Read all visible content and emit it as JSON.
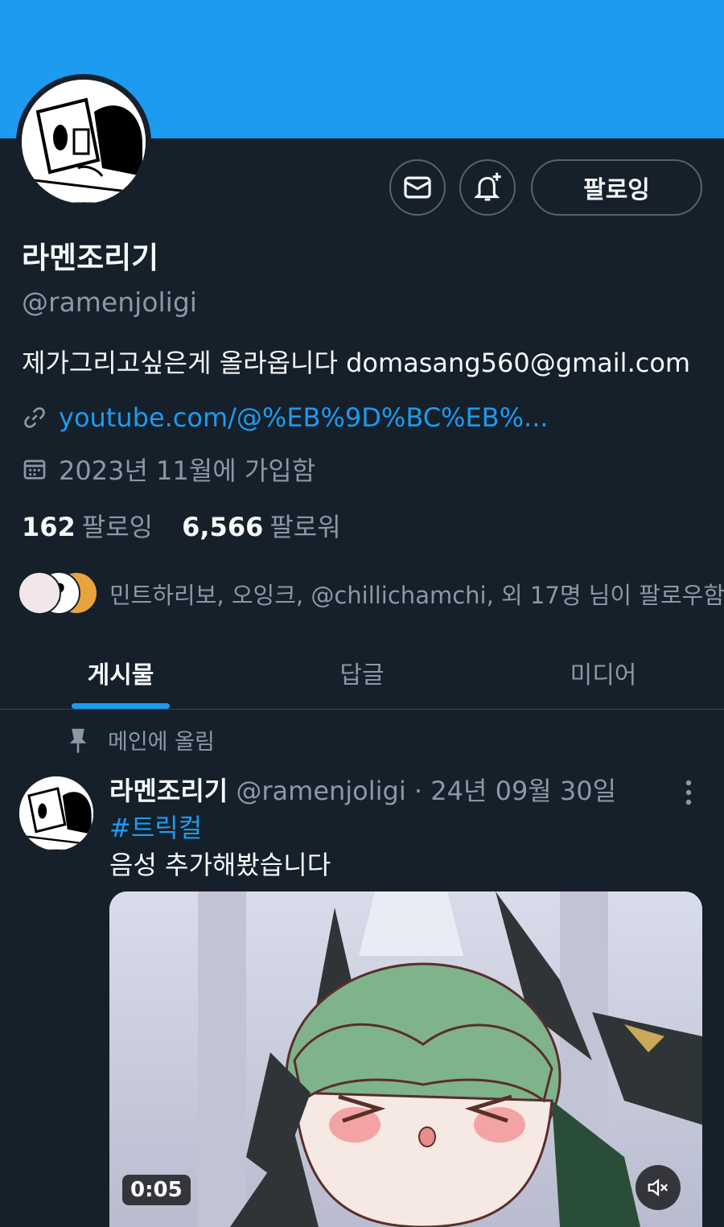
{
  "profile": {
    "display_name": "라멘조리기",
    "handle": "@ramenjoligi",
    "bio": "제가그리고싶은게 올라옵니다  domasang560@gmail.com",
    "link": "youtube.com/@%EB%9D%BC%EB%...",
    "joined": "2023년 11월에 가입함",
    "following_count": "162",
    "following_label": "팔로잉",
    "followers_count": "6,566",
    "followers_label": "팔로워",
    "followers_you_know": "민트하리보, 오잉크, @chillichamchi, 외 17명 님이 팔로우함"
  },
  "actions": {
    "follow_label": "팔로잉",
    "message_icon": "mail-icon",
    "notify_icon": "bell-plus-icon"
  },
  "tabs": [
    {
      "label": "게시물",
      "active": true
    },
    {
      "label": "답글",
      "active": false
    },
    {
      "label": "미디어",
      "active": false
    }
  ],
  "pinned_post": {
    "pinned_label": "메인에 올림",
    "author_name": "라멘조리기",
    "author_handle_date": "@ramenjoligi · 24년 09월 30일",
    "hashtag": "#트릭컬",
    "text": "음성 추가해봤습니다",
    "video_duration": "0:05"
  },
  "colors": {
    "banner": "#1d9bf0",
    "background": "#15202b",
    "accent": "#1d9bf0",
    "muted_text": "#8b98a5"
  }
}
